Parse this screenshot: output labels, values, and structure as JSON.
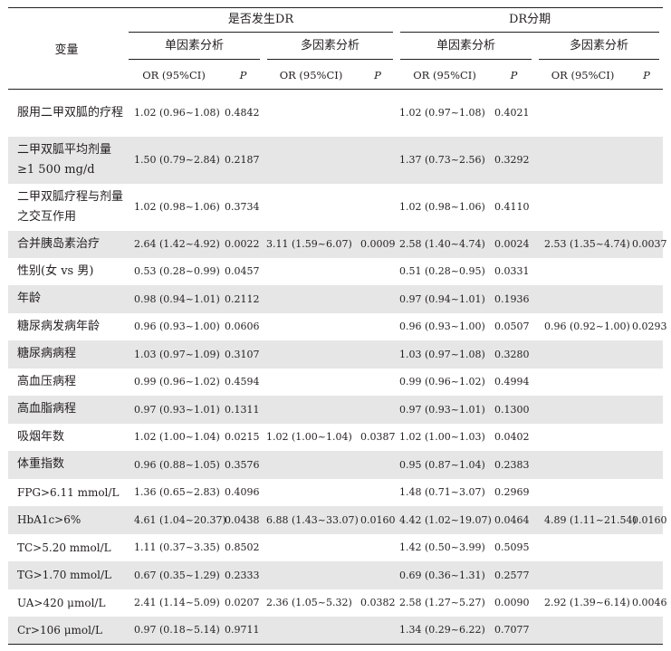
{
  "header": {
    "var_label": "变量",
    "group1": "是否发生DR",
    "group2": "DR分期",
    "uni": "单因素分析",
    "multi": "多因素分析",
    "or_label": "OR (95%CI)",
    "p_label": "P"
  },
  "rows": [
    {
      "var": "服用二甲双胍的疗程",
      "g1_uni_or": "1.02 (0.96~1.08)",
      "g1_uni_p": "0.4842",
      "g1_multi_or": "",
      "g1_multi_p": "",
      "g2_uni_or": "1.02 (0.97~1.08)",
      "g2_uni_p": "0.4021",
      "g2_multi_or": "",
      "g2_multi_p": ""
    },
    {
      "var": "二甲双胍平均剂量≥1 500 mg/d",
      "g1_uni_or": "1.50 (0.79~2.84)",
      "g1_uni_p": "0.2187",
      "g1_multi_or": "",
      "g1_multi_p": "",
      "g2_uni_or": "1.37 (0.73~2.56)",
      "g2_uni_p": "0.3292",
      "g2_multi_or": "",
      "g2_multi_p": ""
    },
    {
      "var": "二甲双胍疗程与剂量之交互作用",
      "g1_uni_or": "1.02 (0.98~1.06)",
      "g1_uni_p": "0.3734",
      "g1_multi_or": "",
      "g1_multi_p": "",
      "g2_uni_or": "1.02 (0.98~1.06)",
      "g2_uni_p": "0.4110",
      "g2_multi_or": "",
      "g2_multi_p": ""
    },
    {
      "var": "合并胰岛素治疗",
      "g1_uni_or": "2.64 (1.42~4.92)",
      "g1_uni_p": "0.0022",
      "g1_multi_or": "3.11 (1.59~6.07)",
      "g1_multi_p": "0.0009",
      "g2_uni_or": "2.58 (1.40~4.74)",
      "g2_uni_p": "0.0024",
      "g2_multi_or": "2.53 (1.35~4.74)",
      "g2_multi_p": "0.0037"
    },
    {
      "var": "性别(女 vs 男)",
      "g1_uni_or": "0.53 (0.28~0.99)",
      "g1_uni_p": "0.0457",
      "g1_multi_or": "",
      "g1_multi_p": "",
      "g2_uni_or": "0.51 (0.28~0.95)",
      "g2_uni_p": "0.0331",
      "g2_multi_or": "",
      "g2_multi_p": ""
    },
    {
      "var": "年龄",
      "g1_uni_or": "0.98 (0.94~1.01)",
      "g1_uni_p": "0.2112",
      "g1_multi_or": "",
      "g1_multi_p": "",
      "g2_uni_or": "0.97 (0.94~1.01)",
      "g2_uni_p": "0.1936",
      "g2_multi_or": "",
      "g2_multi_p": ""
    },
    {
      "var": "糖尿病发病年龄",
      "g1_uni_or": "0.96 (0.93~1.00)",
      "g1_uni_p": "0.0606",
      "g1_multi_or": "",
      "g1_multi_p": "",
      "g2_uni_or": "0.96 (0.93~1.00)",
      "g2_uni_p": "0.0507",
      "g2_multi_or": "0.96 (0.92~1.00)",
      "g2_multi_p": "0.0293"
    },
    {
      "var": "糖尿病病程",
      "g1_uni_or": "1.03 (0.97~1.09)",
      "g1_uni_p": "0.3107",
      "g1_multi_or": "",
      "g1_multi_p": "",
      "g2_uni_or": "1.03 (0.97~1.08)",
      "g2_uni_p": "0.3280",
      "g2_multi_or": "",
      "g2_multi_p": ""
    },
    {
      "var": "高血压病程",
      "g1_uni_or": "0.99 (0.96~1.02)",
      "g1_uni_p": "0.4594",
      "g1_multi_or": "",
      "g1_multi_p": "",
      "g2_uni_or": "0.99 (0.96~1.02)",
      "g2_uni_p": "0.4994",
      "g2_multi_or": "",
      "g2_multi_p": ""
    },
    {
      "var": "高血脂病程",
      "g1_uni_or": "0.97 (0.93~1.01)",
      "g1_uni_p": "0.1311",
      "g1_multi_or": "",
      "g1_multi_p": "",
      "g2_uni_or": "0.97 (0.93~1.01)",
      "g2_uni_p": "0.1300",
      "g2_multi_or": "",
      "g2_multi_p": ""
    },
    {
      "var": "吸烟年数",
      "g1_uni_or": "1.02 (1.00~1.04)",
      "g1_uni_p": "0.0215",
      "g1_multi_or": "1.02 (1.00~1.04)",
      "g1_multi_p": "0.0387",
      "g2_uni_or": "1.02 (1.00~1.03)",
      "g2_uni_p": "0.0402",
      "g2_multi_or": "",
      "g2_multi_p": ""
    },
    {
      "var": "体重指数",
      "g1_uni_or": "0.96 (0.88~1.05)",
      "g1_uni_p": "0.3576",
      "g1_multi_or": "",
      "g1_multi_p": "",
      "g2_uni_or": "0.95 (0.87~1.04)",
      "g2_uni_p": "0.2383",
      "g2_multi_or": "",
      "g2_multi_p": ""
    },
    {
      "var": "FPG>6.11 mmol/L",
      "g1_uni_or": "1.36 (0.65~2.83)",
      "g1_uni_p": "0.4096",
      "g1_multi_or": "",
      "g1_multi_p": "",
      "g2_uni_or": "1.48 (0.71~3.07)",
      "g2_uni_p": "0.2969",
      "g2_multi_or": "",
      "g2_multi_p": ""
    },
    {
      "var": "HbA1c>6%",
      "g1_uni_or": "4.61 (1.04~20.37)",
      "g1_uni_p": "0.0438",
      "g1_multi_or": "6.88 (1.43~33.07)",
      "g1_multi_p": "0.0160",
      "g2_uni_or": "4.42 (1.02~19.07)",
      "g2_uni_p": "0.0464",
      "g2_multi_or": "4.89 (1.11~21.54)",
      "g2_multi_p": "0.0160"
    },
    {
      "var": "TC>5.20 mmol/L",
      "g1_uni_or": "1.11 (0.37~3.35)",
      "g1_uni_p": "0.8502",
      "g1_multi_or": "",
      "g1_multi_p": "",
      "g2_uni_or": "1.42 (0.50~3.99)",
      "g2_uni_p": "0.5095",
      "g2_multi_or": "",
      "g2_multi_p": ""
    },
    {
      "var": "TG>1.70 mmol/L",
      "g1_uni_or": "0.67 (0.35~1.29)",
      "g1_uni_p": "0.2333",
      "g1_multi_or": "",
      "g1_multi_p": "",
      "g2_uni_or": "0.69 (0.36~1.31)",
      "g2_uni_p": "0.2577",
      "g2_multi_or": "",
      "g2_multi_p": ""
    },
    {
      "var": "UA>420 μmol/L",
      "g1_uni_or": "2.41 (1.14~5.09)",
      "g1_uni_p": "0.0207",
      "g1_multi_or": "2.36 (1.05~5.32)",
      "g1_multi_p": "0.0382",
      "g2_uni_or": "2.58 (1.27~5.27)",
      "g2_uni_p": "0.0090",
      "g2_multi_or": "2.92 (1.39~6.14)",
      "g2_multi_p": "0.0046"
    },
    {
      "var": "Cr>106 μmol/L",
      "g1_uni_or": "0.97 (0.18~5.14)",
      "g1_uni_p": "0.9711",
      "g1_multi_or": "",
      "g1_multi_p": "",
      "g2_uni_or": "1.34 (0.29~6.22)",
      "g2_uni_p": "0.7077",
      "g2_multi_or": "",
      "g2_multi_p": ""
    }
  ]
}
